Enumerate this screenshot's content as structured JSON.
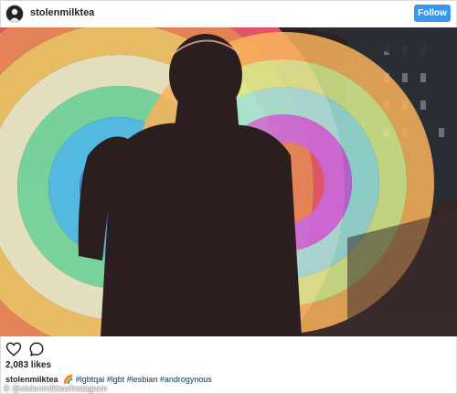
{
  "header": {
    "username": "stolenmilktea",
    "follow_label": "Follow"
  },
  "post": {
    "image_icon": "photo-light-painting-silhouette",
    "likes": "2,083 likes",
    "caption_user": "stolenmilktea",
    "caption_tags": "🌈 #lgbtqai #lgbt #lesbian #androgynous",
    "watermark": "© @stolenmilktea/Instagram"
  },
  "icons": {
    "like": "heart-icon",
    "comment": "comment-bubble-icon"
  },
  "colors": {
    "follow_bg": "#3897f0",
    "hashtag": "#003569",
    "text": "#262626"
  }
}
